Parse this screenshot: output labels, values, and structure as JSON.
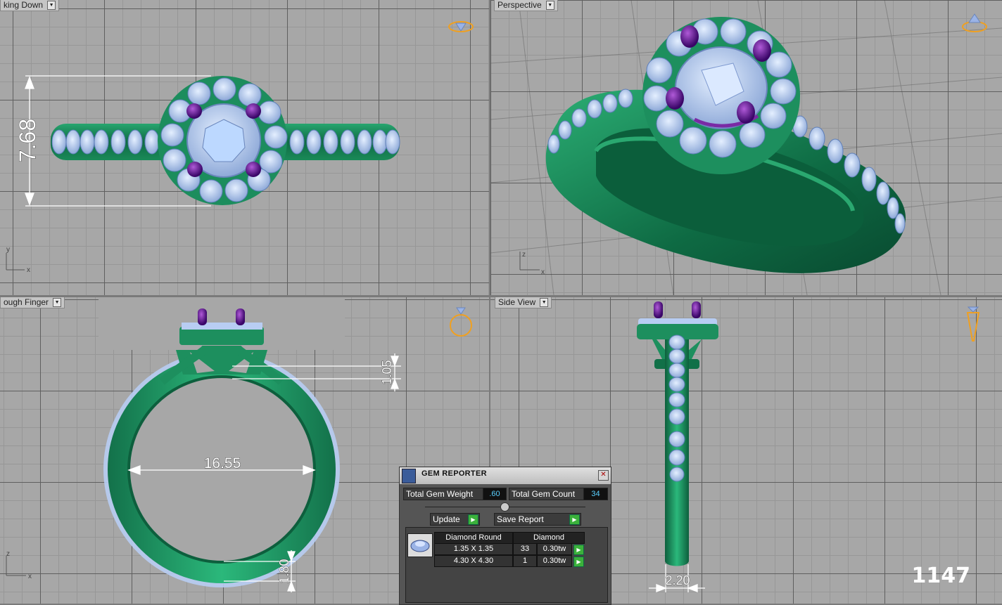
{
  "viewports": {
    "top": {
      "title": "king Down"
    },
    "perspective": {
      "title": "Perspective"
    },
    "front": {
      "title": "ough Finger"
    },
    "side": {
      "title": "Side View"
    }
  },
  "axes": {
    "x": "x",
    "y": "y",
    "z": "z"
  },
  "dimensions": {
    "top_height": "7.68",
    "front_width": "16.55",
    "front_gap": "1.05",
    "front_shank": "1.80",
    "side_width": "2.20"
  },
  "gem_reporter": {
    "title": "GEM REPORTER",
    "total_weight_label": "Total Gem Weight",
    "total_weight_value": ".60",
    "total_count_label": "Total Gem Count",
    "total_count_value": "34",
    "update_label": "Update",
    "save_label": "Save Report",
    "col_shape": "Diamond Round",
    "col_material": "Diamond",
    "rows": [
      {
        "size": "1.35 X 1.35",
        "count": "33",
        "weight": "0.30tw"
      },
      {
        "size": "4.30 X 4.30",
        "count": "1",
        "weight": "0.30tw"
      }
    ]
  },
  "watermark": "1147",
  "colors": {
    "metal": "#1f8a5c",
    "gem": "#b8cdf3",
    "prong": "#5a1288",
    "dimension": "#ffffff",
    "icon": "#f0a020"
  }
}
